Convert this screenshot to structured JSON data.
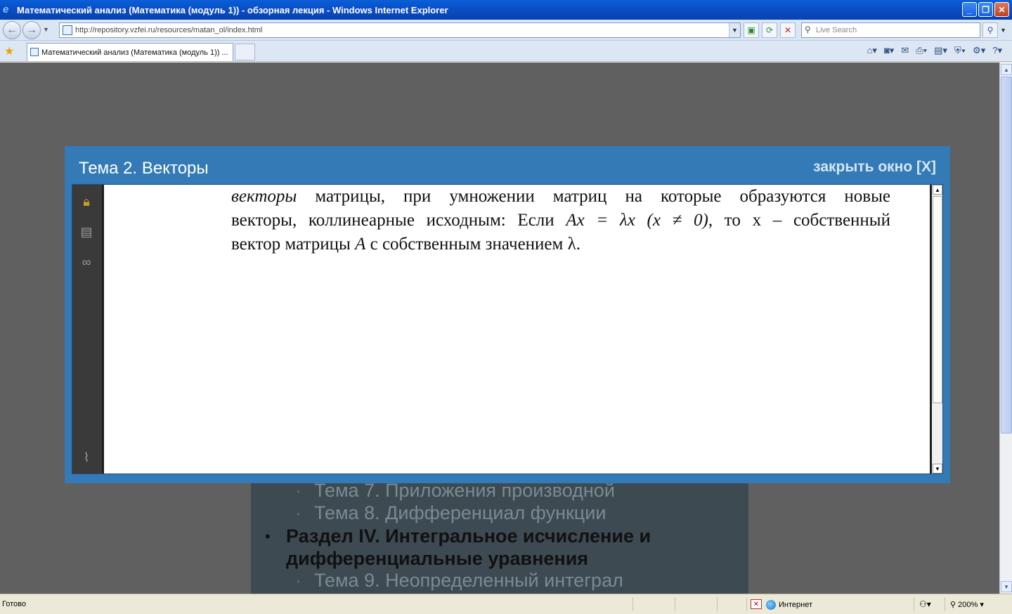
{
  "window": {
    "title": "Математический анализ (Математика (модуль 1)) - обзорная лекция - Windows Internet Explorer",
    "minimize": "_",
    "maximize": "❐",
    "close": "✕"
  },
  "address": {
    "url": "http://repository.vzfei.ru/resources/matan_ol/index.html",
    "search_placeholder": "Live Search"
  },
  "tabs": [
    {
      "label": "Математический анализ (Математика (модуль 1)) ..."
    }
  ],
  "modal": {
    "title": "Тема 2. Векторы",
    "close_label": "закрыть окно [X]"
  },
  "pdf": {
    "line1_italic": "векторы",
    "line1_rest": " матрицы, при умножении матриц на которые образуются новые",
    "line2": "векторы, коллинеарные исходным: Если ",
    "line2_math": "Ax = λx (x ≠ 0)",
    "line2_rest": ", то x – собственный",
    "line3_start": "вектор матрицы ",
    "line3_math": "A",
    "line3_rest": " с собственным значением λ."
  },
  "page_list": {
    "topic7": "Тема 7. Приложения производной",
    "topic8": "Тема 8. Дифференциал функции",
    "section4": "Раздел IV. Интегральное исчисление и дифференциальные уравнения",
    "topic9": "Тема 9. Неопределенный интеграл"
  },
  "status": {
    "text": "Готово",
    "zone": "Интернет",
    "zoom": "200%"
  },
  "icons": {
    "lock": "lock-icon",
    "pages": "pages-icon",
    "binoculars": "binoculars-icon",
    "attachment": "paperclip-icon"
  }
}
